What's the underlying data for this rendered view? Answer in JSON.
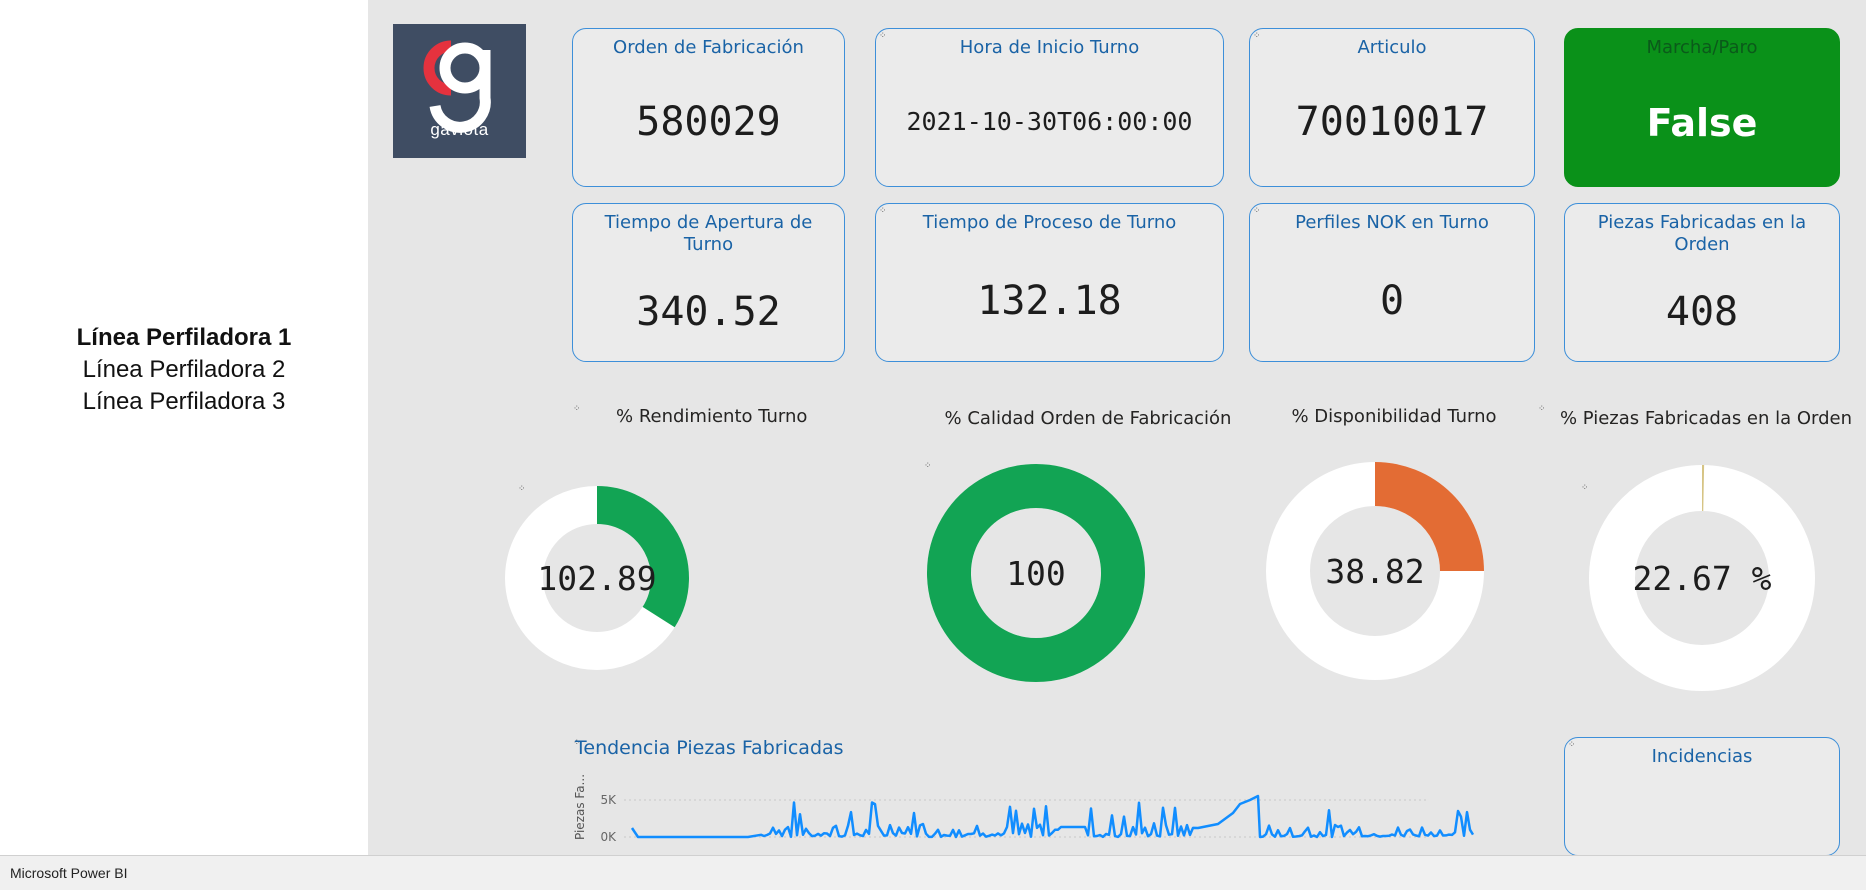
{
  "sidebar": {
    "items": [
      {
        "label": "Línea Perfiladora 1",
        "active": true
      },
      {
        "label": "Línea Perfiladora 2",
        "active": false
      },
      {
        "label": "Línea Perfiladora 3",
        "active": false
      }
    ]
  },
  "logo": {
    "text": "gaviota",
    "colors": {
      "background": "#3f4d63",
      "accent": "#e5323e",
      "letter": "#ffffff"
    }
  },
  "cards": {
    "orden": {
      "title": "Orden de Fabricación",
      "value": "580029"
    },
    "hora": {
      "title": "Hora de Inicio Turno",
      "value": "2021-10-30T06:00:00"
    },
    "articulo": {
      "title": "Articulo",
      "value": "70010017"
    },
    "marcha": {
      "title": "Marcha/Paro",
      "value": "False",
      "color": "#0a9119"
    },
    "apertura": {
      "title": "Tiempo de Apertura de Turno",
      "value": "340.52"
    },
    "proceso": {
      "title": "Tiempo de Proceso de Turno",
      "value": "132.18"
    },
    "nok": {
      "title": "Perfiles NOK en Turno",
      "value": "0"
    },
    "piezas": {
      "title": "Piezas Fabricadas en la Orden",
      "value": "408"
    },
    "incidencias": {
      "title": "Incidencias",
      "value": ""
    }
  },
  "donuts": {
    "rendimiento": {
      "title": "% Rendimiento Turno",
      "label": "102.89",
      "fraction": 0.34,
      "color": "#12a454"
    },
    "calidad": {
      "title": "% Calidad Orden de Fabricación",
      "label": "100",
      "fraction": 1.0,
      "color": "#12a454"
    },
    "disponibilidad": {
      "title": "% Disponibilidad Turno",
      "label": "38.82",
      "fraction": 0.25,
      "color": "#e36c34"
    },
    "piezas": {
      "title": "% Piezas Fabricadas en la Orden",
      "label": "22.67 %",
      "fraction": 0.004,
      "color": "#d6c484"
    }
  },
  "trend": {
    "title": "Tendencia Piezas Fabricadas",
    "ylabel": "Piezas Fa...",
    "yticks": [
      "5K",
      "0K"
    ],
    "color": "#118dff"
  },
  "taskbar": {
    "label": "Microsoft Power BI"
  }
}
